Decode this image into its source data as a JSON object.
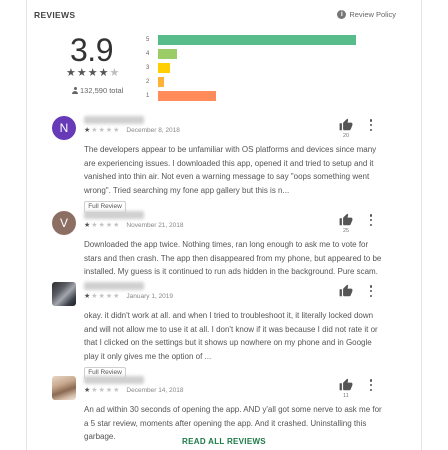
{
  "header": {
    "title": "REVIEWS",
    "policy_label": "Review Policy",
    "policy_icon": "info-icon"
  },
  "summary": {
    "rating": "3.9",
    "stars_filled": 4,
    "stars_total": 5,
    "total": "132,590 total",
    "histogram": [
      {
        "label": "5",
        "share": 0.95,
        "color": "#57bb8a"
      },
      {
        "label": "4",
        "share": 0.09,
        "color": "#9ccc65"
      },
      {
        "label": "3",
        "share": 0.06,
        "color": "#ffcf02"
      },
      {
        "label": "2",
        "share": 0.03,
        "color": "#ffb235"
      },
      {
        "label": "1",
        "share": 0.28,
        "color": "#ff8c5a"
      }
    ]
  },
  "reviews": [
    {
      "avatar_letter": "N",
      "avatar_color": "#673ab7",
      "rating": 1,
      "date": "December 8, 2018",
      "text": "The developers appear to be unfamiliar with OS platforms and devices since many are experiencing issues. I downloaded this app, opened it and tried to setup and it vanished into thin air. Not even a warning message to say \"oops something went wrong\". Tried searching my fone app gallery but this is n...",
      "full_review_label": "Full Review",
      "likes": "20"
    },
    {
      "avatar_letter": "V",
      "avatar_color": "#8d6e63",
      "rating": 1,
      "date": "November 21, 2018",
      "text": "Downloaded the app twice. Nothing times, ran long enough to ask me to vote for stars and then crash. The app then disappeared from my phone, but appeared to be installed. My guess is it continued to run ads hidden in the background. Pure scam.",
      "likes": "25"
    },
    {
      "avatar_letter": "",
      "avatar_color": "#555555",
      "rating": 1,
      "date": "January 1, 2019",
      "text": "okay. it didn't work at all. and when I tried to troubleshoot it, it literally locked down and will not allow me to use it at all. I don't know if it was because I did not rate it or that I clicked on the settings but it shows up nowhere on my phone and in Google play it only gives me the option of ...",
      "full_review_label": "Full Review",
      "likes": ""
    },
    {
      "avatar_letter": "",
      "avatar_color": "#c9a98f",
      "rating": 1,
      "date": "December 14, 2018",
      "text": "An ad within 30 seconds of opening the app. AND y'all got some nerve to ask me for a 5 star review, moments after opening the app. And it crashed. Uninstalling this garbage.",
      "likes": "11"
    }
  ],
  "read_all_label": "READ ALL REVIEWS"
}
